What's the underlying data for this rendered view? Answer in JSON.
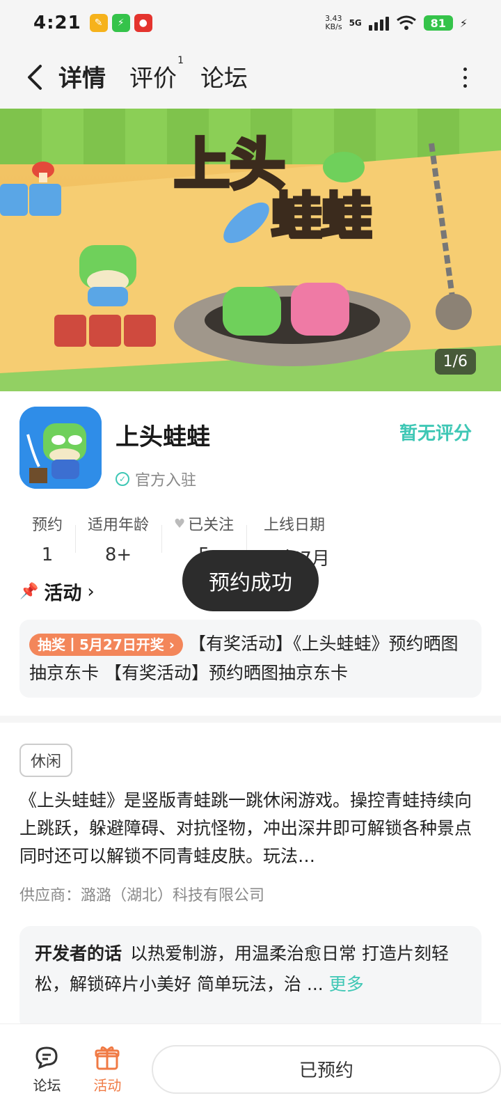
{
  "status": {
    "time": "4:21",
    "net_speed_value": "3.43",
    "net_speed_unit": "KB/s",
    "net_type": "5G",
    "battery": "81"
  },
  "nav": {
    "tabs": [
      {
        "label": "详情",
        "active": true
      },
      {
        "label": "评价",
        "badge": "1"
      },
      {
        "label": "论坛"
      }
    ]
  },
  "banner": {
    "counter": "1/6"
  },
  "app": {
    "name": "上头蛙蛙",
    "official_label": "官方入驻",
    "rating_text": "暂无评分"
  },
  "stats": [
    {
      "label": "预约",
      "value": "1"
    },
    {
      "label": "适用年龄",
      "value": "8+"
    },
    {
      "label": "已关注",
      "value": "5"
    },
    {
      "label": "上线日期",
      "value": "26年7月"
    }
  ],
  "toast": "预约成功",
  "activity": {
    "header": "活动",
    "tag": "抽奖丨5月27日开奖",
    "text": "【有奖活动】《上头蛙蛙》预约晒图抽京东卡 【有奖活动】预约晒图抽京东卡"
  },
  "genre_tag": "休闲",
  "description": "《上头蛙蛙》是竖版青蛙跳一跳休闲游戏。操控青蛙持续向上跳跃，躲避障碍、对抗怪物，冲出深井即可解锁各种景点同时还可以解锁不同青蛙皮肤。玩法…",
  "supplier": "供应商：潞潞（湖北）科技有限公司",
  "developer": {
    "title": "开发者的话",
    "text": "以热爱制游，用温柔治愈日常 打造片刻轻松，解锁碎片小美好 简单玩法，治 ...",
    "more": "更多"
  },
  "bottom": {
    "forum_label": "论坛",
    "activity_label": "活动",
    "reserve_label": "已预约"
  },
  "colors": {
    "accent": "#3ec7b5",
    "orange": "#f07a44"
  }
}
